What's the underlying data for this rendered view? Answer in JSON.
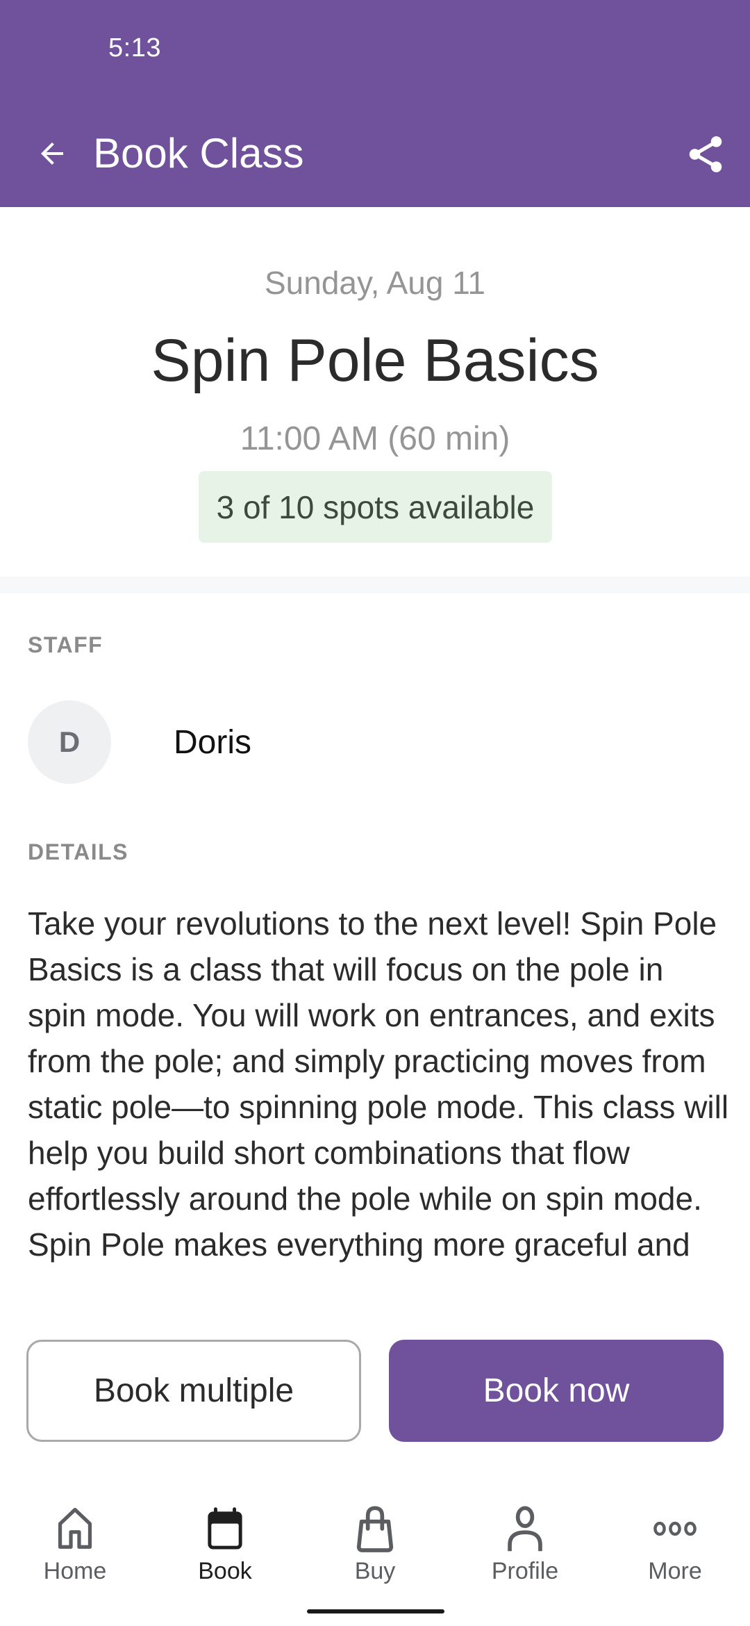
{
  "status_bar": {
    "time": "5:13"
  },
  "app_bar": {
    "title": "Book Class",
    "back_icon": "arrow-left-icon",
    "share_icon": "share-icon",
    "background_color": "#6f529b"
  },
  "class": {
    "date": "Sunday, Aug 11",
    "title": "Spin Pole Basics",
    "time": "11:00 AM (60 min)",
    "availability": "3 of 10 spots available",
    "availability_color": "#e6f3e6"
  },
  "staff": {
    "section_label": "STAFF",
    "members": [
      {
        "initial": "D",
        "name": "Doris"
      }
    ]
  },
  "details": {
    "section_label": "DETAILS",
    "text": "Take your revolutions to the next level! Spin Pole Basics is a class that will focus on the pole in spin mode. You will work on entrances, and exits from the pole; and simply practicing moves from static pole—to spinning pole mode. This class will help you build short combinations that flow effortlessly around the pole while on spin mode. Spin Pole makes everything more graceful and"
  },
  "actions": {
    "book_multiple_label": "Book multiple",
    "book_now_label": "Book now"
  },
  "bottom_nav": {
    "active": "Book",
    "items": [
      {
        "label": "Home",
        "icon": "home-icon"
      },
      {
        "label": "Book",
        "icon": "calendar-icon"
      },
      {
        "label": "Buy",
        "icon": "shopping-bag-icon"
      },
      {
        "label": "Profile",
        "icon": "person-icon"
      },
      {
        "label": "More",
        "icon": "more-dots-icon"
      }
    ]
  }
}
